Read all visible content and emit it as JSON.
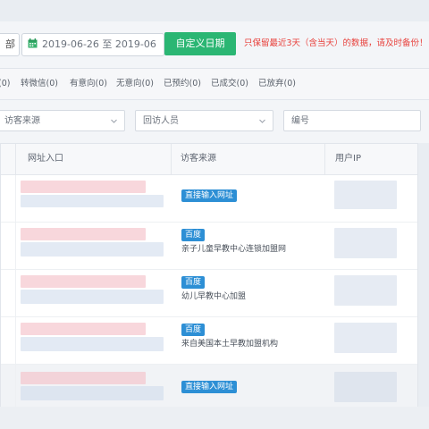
{
  "filter_bar": {
    "left_button_label": "部",
    "date_range": "2019-06-26 至 2019-06",
    "custom_date_label": "自定义日期",
    "warning": "只保留最近3天（含当天）的数据，请及时备份！"
  },
  "status_tabs": [
    "(0)",
    "转微信(0)",
    "有意向(0)",
    "无意向(0)",
    "已预约(0)",
    "已成交(0)",
    "已放弃(0)"
  ],
  "search": {
    "source_placeholder": "访客来源",
    "staff_placeholder": "回访人员",
    "number_placeholder": "编号"
  },
  "table": {
    "headers": [
      "网址入口",
      "访客来源",
      "用户IP"
    ],
    "rows": [
      {
        "badge": "直接输入网址",
        "source_text": ""
      },
      {
        "badge": "百度",
        "source_text": "亲子儿童早教中心连锁加盟网"
      },
      {
        "badge": "百度",
        "source_text": "幼儿早教中心加盟"
      },
      {
        "badge": "百度",
        "source_text": "来自美国本土早教加盟机构"
      },
      {
        "badge": "直接输入网址",
        "source_text": ""
      }
    ]
  },
  "colors": {
    "accent_green": "#2bb673",
    "badge_blue": "#2d8fd5",
    "warning_red": "#e8413c"
  },
  "icons": [
    "calendar-icon",
    "chevron-down-icon"
  ]
}
